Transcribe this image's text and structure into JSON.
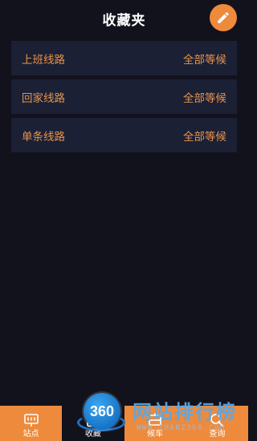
{
  "header": {
    "title": "收藏夹",
    "edit_icon": "pencil-icon"
  },
  "routes": [
    {
      "name": "上班线路",
      "status": "全部等候"
    },
    {
      "name": "回家线路",
      "status": "全部等候"
    },
    {
      "name": "单条线路",
      "status": "全部等候"
    }
  ],
  "tabs": [
    {
      "label": "站点",
      "icon": "bus-stop-icon",
      "active": false
    },
    {
      "label": "收藏",
      "icon": "bookmark-icon",
      "active": true
    },
    {
      "label": "候车",
      "icon": "bus-wait-icon",
      "active": false
    },
    {
      "label": "查询",
      "icon": "search-icon",
      "active": false
    }
  ],
  "watermark": {
    "badge": "360",
    "text": "网站排行榜",
    "url": "WWW.ZHANZ360.COM"
  },
  "colors": {
    "accent": "#ee8a3c",
    "background": "#12121c",
    "row_background": "#1b2035",
    "row_text": "#e8934a"
  }
}
